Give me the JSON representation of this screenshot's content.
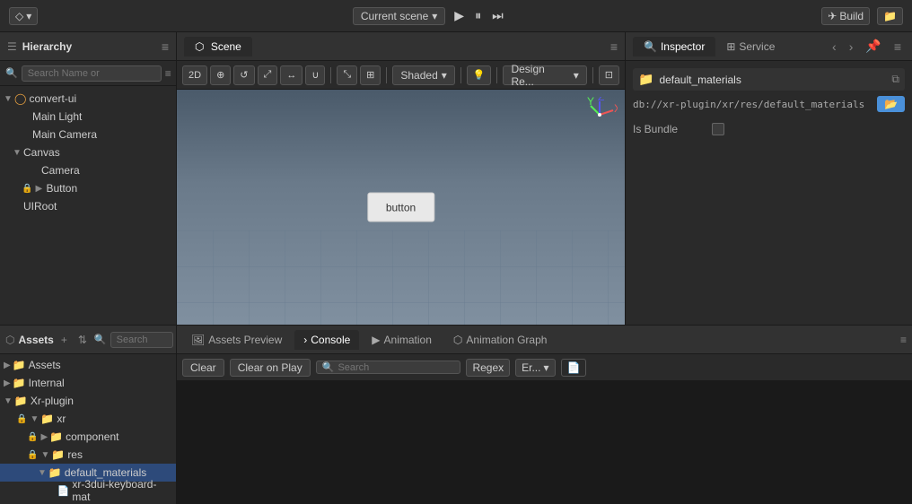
{
  "topbar": {
    "logo_icon": "◇",
    "scene_dropdown": "Current scene",
    "build_label": "Build",
    "folder_icon": "📁"
  },
  "hierarchy": {
    "title": "Hierarchy",
    "search_placeholder": "Search Name or",
    "tree_items": [
      {
        "id": "convert-ui",
        "label": "convert-ui",
        "level": 0,
        "has_arrow": true,
        "arrow_open": true,
        "icon": "◯",
        "icon_color": "#e8a040"
      },
      {
        "id": "main-light",
        "label": "Main Light",
        "level": 1,
        "has_arrow": false,
        "icon": "",
        "icon_color": ""
      },
      {
        "id": "main-camera",
        "label": "Main Camera",
        "level": 1,
        "has_arrow": false,
        "icon": "",
        "icon_color": ""
      },
      {
        "id": "canvas",
        "label": "Canvas",
        "level": 1,
        "has_arrow": true,
        "arrow_open": true,
        "icon": "",
        "icon_color": ""
      },
      {
        "id": "camera",
        "label": "Camera",
        "level": 2,
        "has_arrow": false,
        "icon": "",
        "icon_color": ""
      },
      {
        "id": "button",
        "label": "Button",
        "level": 2,
        "has_arrow": true,
        "arrow_open": false,
        "icon": "",
        "icon_color": ""
      },
      {
        "id": "uiroot",
        "label": "UIRoot",
        "level": 1,
        "has_arrow": false,
        "icon": "",
        "icon_color": ""
      }
    ]
  },
  "scene": {
    "tab_label": "Scene",
    "button_label": "button",
    "shaded_label": "Shaded",
    "design_label": "Design Re...",
    "toolbar_buttons": [
      "2D",
      "⊕",
      "↺",
      "⤢",
      "↔",
      "∪"
    ]
  },
  "inspector": {
    "tab_label": "Inspector",
    "tab_icon": "🔍",
    "service_tab_label": "Service",
    "service_tab_icon": "⊞",
    "folder_name": "default_materials",
    "path": "db://xr-plugin/xr/res/default_materials",
    "is_bundle_label": "Is Bundle"
  },
  "assets": {
    "title": "Assets",
    "search_placeholder": "Search",
    "tree_items": [
      {
        "id": "assets",
        "label": "Assets",
        "level": 0,
        "has_arrow": true,
        "arrow_open": false,
        "icon": "folder",
        "color": "#c8a050"
      },
      {
        "id": "internal",
        "label": "Internal",
        "level": 0,
        "has_arrow": true,
        "arrow_open": false,
        "icon": "folder",
        "color": "#c8a050"
      },
      {
        "id": "xr-plugin",
        "label": "Xr-plugin",
        "level": 0,
        "has_arrow": true,
        "arrow_open": true,
        "icon": "folder",
        "color": "#c8a050"
      },
      {
        "id": "xr",
        "label": "xr",
        "level": 1,
        "has_arrow": true,
        "arrow_open": true,
        "icon": "folder",
        "color": "#4a90d9"
      },
      {
        "id": "component",
        "label": "component",
        "level": 2,
        "has_arrow": true,
        "arrow_open": false,
        "icon": "folder",
        "color": "#4a90d9"
      },
      {
        "id": "res",
        "label": "res",
        "level": 2,
        "has_arrow": true,
        "arrow_open": true,
        "icon": "folder",
        "color": "#4a90d9"
      },
      {
        "id": "default_materials",
        "label": "default_materials",
        "level": 3,
        "has_arrow": true,
        "arrow_open": true,
        "icon": "folder",
        "color": "#4a90d9",
        "selected": true
      },
      {
        "id": "xr-3dui-keyboard-mat",
        "label": "xr-3dui-keyboard-mat",
        "level": 4,
        "has_arrow": false,
        "icon": "file",
        "color": "#aaa"
      }
    ]
  },
  "console": {
    "tabs": [
      {
        "id": "assets-preview",
        "label": "Assets Preview",
        "icon": "🖼"
      },
      {
        "id": "console",
        "label": "Console",
        "icon": ">"
      },
      {
        "id": "animation",
        "label": "Animation",
        "icon": "▶"
      },
      {
        "id": "animation-graph",
        "label": "Animation Graph",
        "icon": "⬡"
      }
    ],
    "active_tab": "console",
    "clear_label": "Clear",
    "clear_on_play_label": "Clear on Play",
    "search_placeholder": "Search",
    "regex_label": "Regex",
    "error_dropdown": "Er...",
    "file_icon": "📄"
  }
}
